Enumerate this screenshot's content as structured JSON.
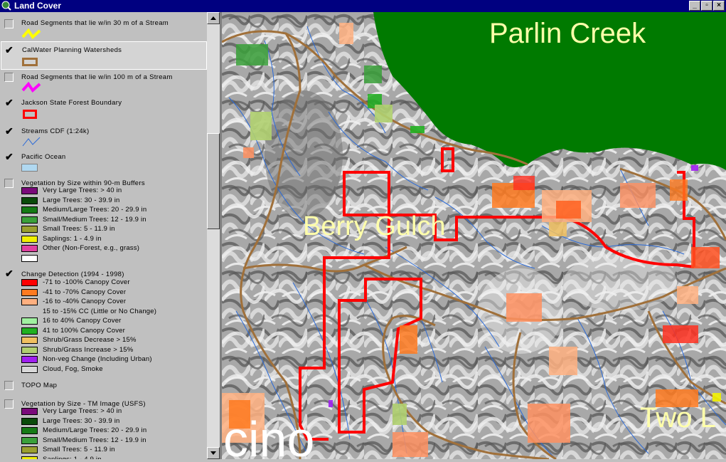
{
  "window": {
    "title": "Land Cover",
    "buttons": [
      "_",
      "▫",
      "×"
    ]
  },
  "legend": {
    "layers": [
      {
        "name": "Road Segments that lie w/in 30 m of a Stream",
        "checked": false
      },
      {
        "name": "CalWater Planning Watersheds",
        "checked": true
      },
      {
        "name": "Road Segments that lie w/in 100 m of a Stream",
        "checked": false
      },
      {
        "name": "Jackson State Forest Boundary",
        "checked": true
      },
      {
        "name": "Streams CDF (1:24k)",
        "checked": true
      },
      {
        "name": "Pacific Ocean",
        "checked": true
      },
      {
        "name": "Vegetation by Size within 90-m Buffers",
        "checked": false,
        "classes": [
          {
            "label": "Very Large Trees: > 40  in",
            "color": "#7a0a7a"
          },
          {
            "label": "Large Trees: 30 - 39.9 in",
            "color": "#0a4a0a"
          },
          {
            "label": "Medium/Large Trees: 20 - 29.9 in",
            "color": "#157a15"
          },
          {
            "label": "Small/Medium Trees: 12 - 19.9 in",
            "color": "#3aa03a"
          },
          {
            "label": "Small Trees: 5 - 11.9 in",
            "color": "#9aa030"
          },
          {
            "label": "Saplings: 1 - 4.9 in",
            "color": "#f0f000"
          },
          {
            "label": "Other (Non-Forest, e.g., grass)",
            "color": "#e040a0"
          },
          {
            "label": "",
            "color": "#ffffff"
          }
        ]
      },
      {
        "name": "Change Detection (1994 - 1998)",
        "checked": true,
        "classes": [
          {
            "label": "-71 to -100% Canopy Cover",
            "color": "#ff0000"
          },
          {
            "label": "-41 to -70% Canopy Cover",
            "color": "#ff7a20"
          },
          {
            "label": "-16 to -40% Canopy Cover",
            "color": "#ffb080"
          },
          {
            "label": "15 to -15% CC (Little or No Change)",
            "color": null
          },
          {
            "label": "16 to 40% Canopy Cover",
            "color": "#a0f0a0"
          },
          {
            "label": "41 to 100% Canopy Cover",
            "color": "#20b020"
          },
          {
            "label": "Shrub/Grass Decrease > 15%",
            "color": "#f0c060"
          },
          {
            "label": "Shrub/Grass Increase > 15%",
            "color": "#b0d070"
          },
          {
            "label": "Non-veg Change (Including Urban)",
            "color": "#a020f0"
          },
          {
            "label": "Cloud, Fog, Smoke",
            "color": "#d8d8d8"
          }
        ]
      },
      {
        "name": "TOPO Map",
        "checked": false
      },
      {
        "name": "Vegetation by Size - TM Image (USFS)",
        "checked": false,
        "classes": [
          {
            "label": "Very Large Trees: > 40  in",
            "color": "#7a0a7a"
          },
          {
            "label": "Large Trees: 30 - 39.9 in",
            "color": "#0a4a0a"
          },
          {
            "label": "Medium/Large Trees: 20 - 29.9 in",
            "color": "#157a15"
          },
          {
            "label": "Small/Medium Trees: 12 - 19.9 in",
            "color": "#3aa03a"
          },
          {
            "label": "Small Trees: 5 - 11.9 in",
            "color": "#9aa030"
          },
          {
            "label": "Saplings: 1 - 4.9 in",
            "color": "#f0f000"
          }
        ]
      }
    ]
  },
  "map": {
    "labels": {
      "parlin": "Parlin Creek",
      "berry": "Berry Gulch",
      "two": "Two L",
      "cino": "cino"
    },
    "colors": {
      "ocean_green": "#007a00",
      "boundary": "#ff0000",
      "watershed": "#a0703a",
      "stream": "#2a6ad8"
    }
  }
}
